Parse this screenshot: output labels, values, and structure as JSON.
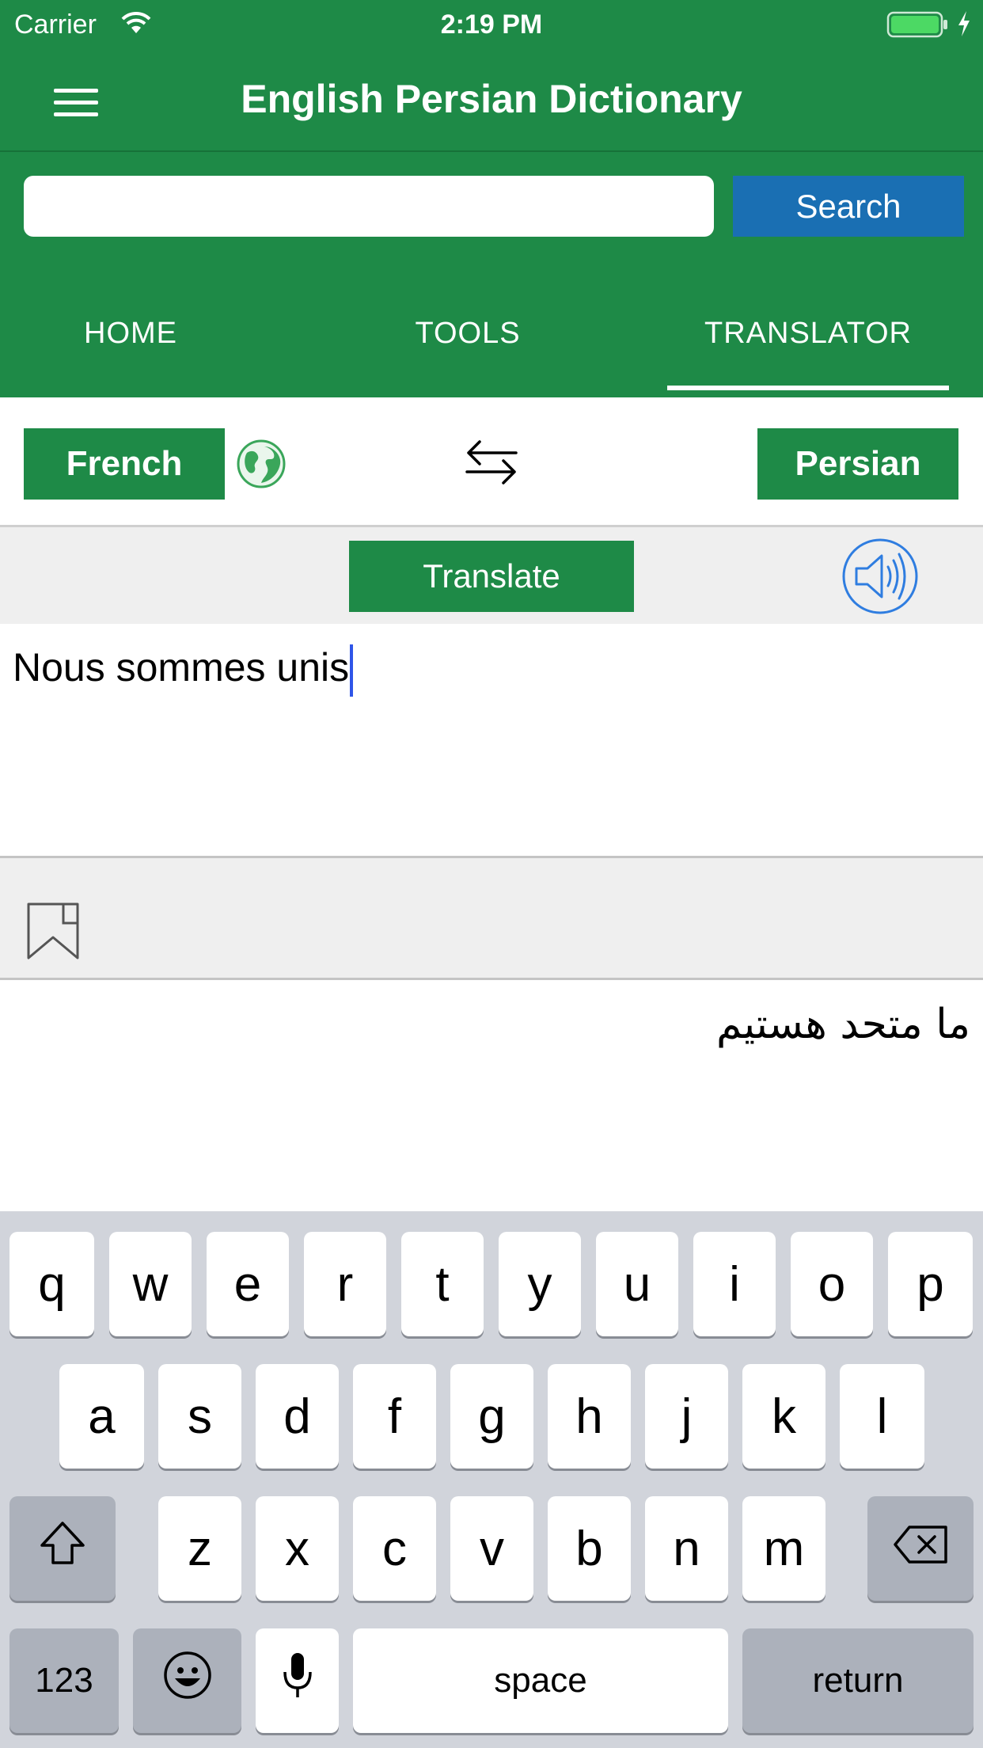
{
  "status": {
    "carrier": "Carrier",
    "time": "2:19 PM"
  },
  "app": {
    "title": "English Persian Dictionary"
  },
  "search": {
    "placeholder": "",
    "value": "",
    "button_label": "Search"
  },
  "tabs": [
    {
      "label": "HOME",
      "active": false
    },
    {
      "label": "TOOLS",
      "active": false
    },
    {
      "label": "TRANSLATOR",
      "active": true
    }
  ],
  "translator": {
    "source_language": "French",
    "target_language": "Persian",
    "translate_label": "Translate",
    "source_text": "Nous sommes unis",
    "result_text": "ما متحد هستیم"
  },
  "keyboard": {
    "row1": [
      "q",
      "w",
      "e",
      "r",
      "t",
      "y",
      "u",
      "i",
      "o",
      "p"
    ],
    "row2": [
      "a",
      "s",
      "d",
      "f",
      "g",
      "h",
      "j",
      "k",
      "l"
    ],
    "row3": [
      "z",
      "x",
      "c",
      "v",
      "b",
      "n",
      "m"
    ],
    "numbers_label": "123",
    "space_label": "space",
    "return_label": "return"
  },
  "icons": {
    "menu": "hamburger-menu-icon",
    "globe": "globe-icon",
    "swap": "swap-arrows-icon",
    "speaker": "speaker-icon",
    "bookmark": "bookmark-icon",
    "shift": "shift-icon",
    "delete": "backspace-icon",
    "emoji": "emoji-icon",
    "mic": "microphone-icon"
  },
  "colors": {
    "primary_green": "#1e8a47",
    "search_blue": "#1a6fb3",
    "speaker_blue": "#2f7de0",
    "caret_blue": "#2f55e8"
  }
}
